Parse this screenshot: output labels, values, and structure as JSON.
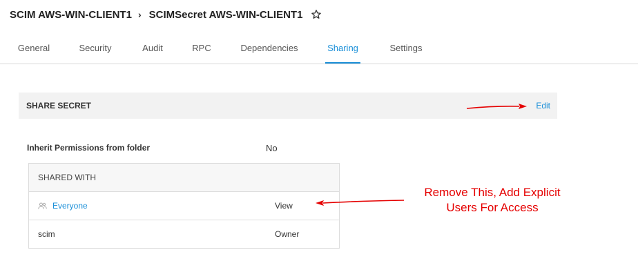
{
  "breadcrumb": {
    "parent": "SCIM AWS-WIN-CLIENT1",
    "separator": "›",
    "current": "SCIMSecret AWS-WIN-CLIENT1"
  },
  "tabs": [
    "General",
    "Security",
    "Audit",
    "RPC",
    "Dependencies",
    "Sharing",
    "Settings"
  ],
  "active_tab": "Sharing",
  "share_section": {
    "title": "SHARE SECRET",
    "edit_label": "Edit"
  },
  "inherit": {
    "label": "Inherit Permissions from folder",
    "value": "No"
  },
  "shared_with": {
    "header": "SHARED WITH",
    "rows": [
      {
        "name": "Everyone",
        "role": "View",
        "icon": "group-icon"
      },
      {
        "name": "scim",
        "role": "Owner"
      }
    ]
  },
  "annotation": {
    "line1": "Remove This, Add Explicit",
    "line2": "Users For Access",
    "color": "#e50000"
  },
  "colors": {
    "accent": "#1a8fd8"
  }
}
